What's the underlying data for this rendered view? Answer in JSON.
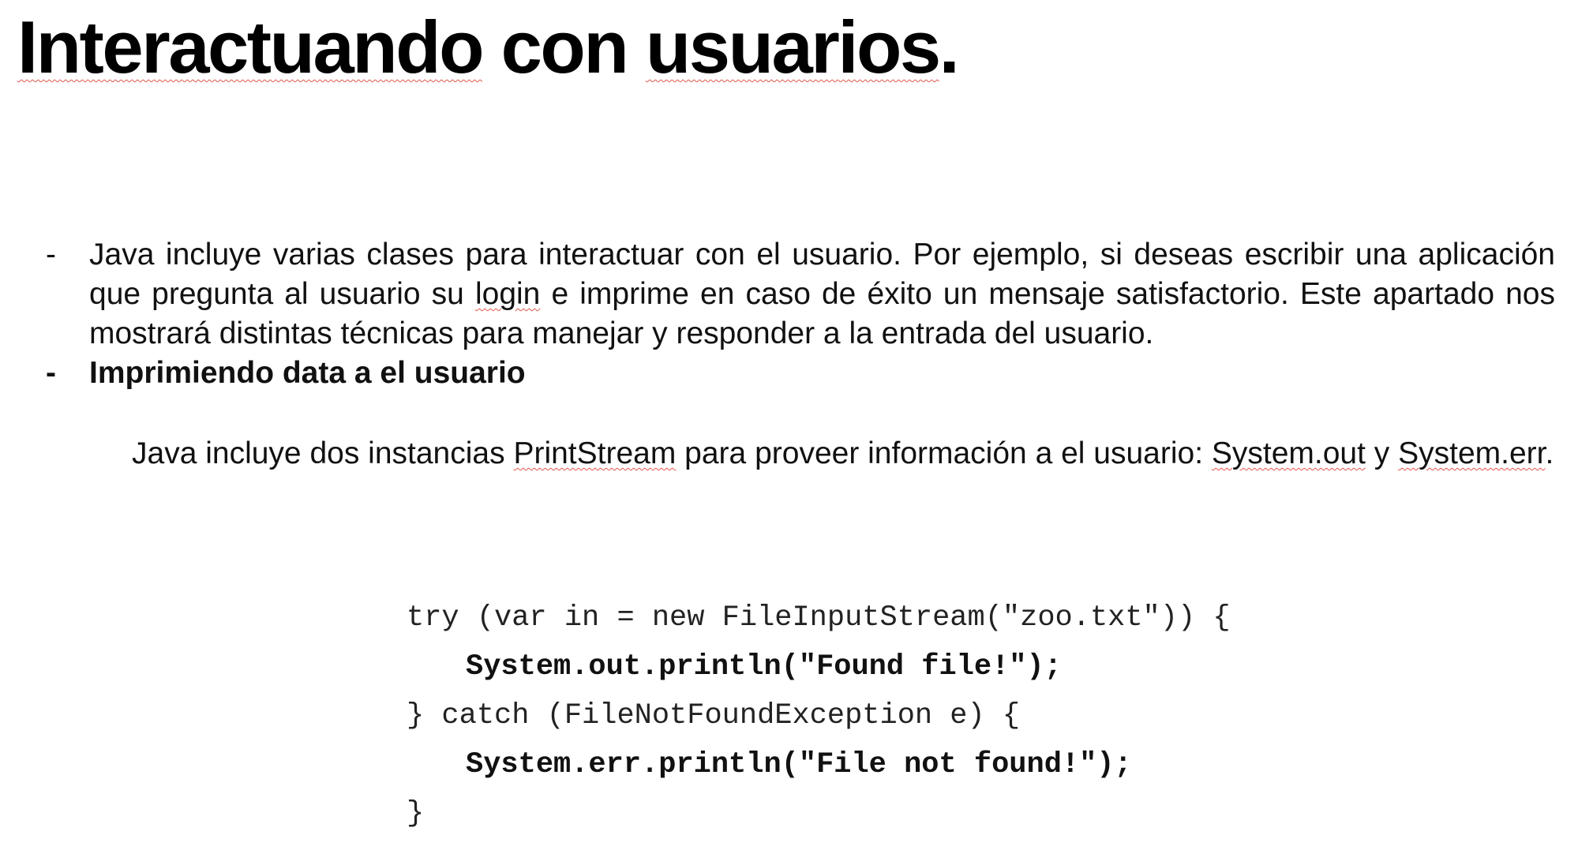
{
  "title": {
    "word1": "Interactuando",
    "word2": " con ",
    "word3": "usuarios",
    "word4": "."
  },
  "bullets": [
    {
      "dash": "-",
      "text_a": "Java incluye varias clases para interactuar con el usuario. Por ejemplo, si deseas escribir una aplicación que pregunta al usuario su ",
      "text_b": "login",
      "text_c": " e imprime en caso de éxito un mensaje satisfactorio. Este apartado nos mostrará distintas técnicas para manejar y responder a la entrada del usuario."
    },
    {
      "dash": "-",
      "text": "Imprimiendo data a el usuario"
    }
  ],
  "paragraph": {
    "text_a": "Java incluye dos instancias ",
    "text_b": "PrintStream",
    "text_c": " para proveer información a el usuario: ",
    "text_d": "System.out",
    "text_e": " y ",
    "text_f": "System.err",
    "text_g": "."
  },
  "code": {
    "lines": [
      "try (var in = new FileInputStream(\"zoo.txt\")) {",
      "System.out.println(\"Found file!\");",
      "} catch (FileNotFoundException e) {",
      "System.err.println(\"File not found!\");",
      "}"
    ]
  }
}
